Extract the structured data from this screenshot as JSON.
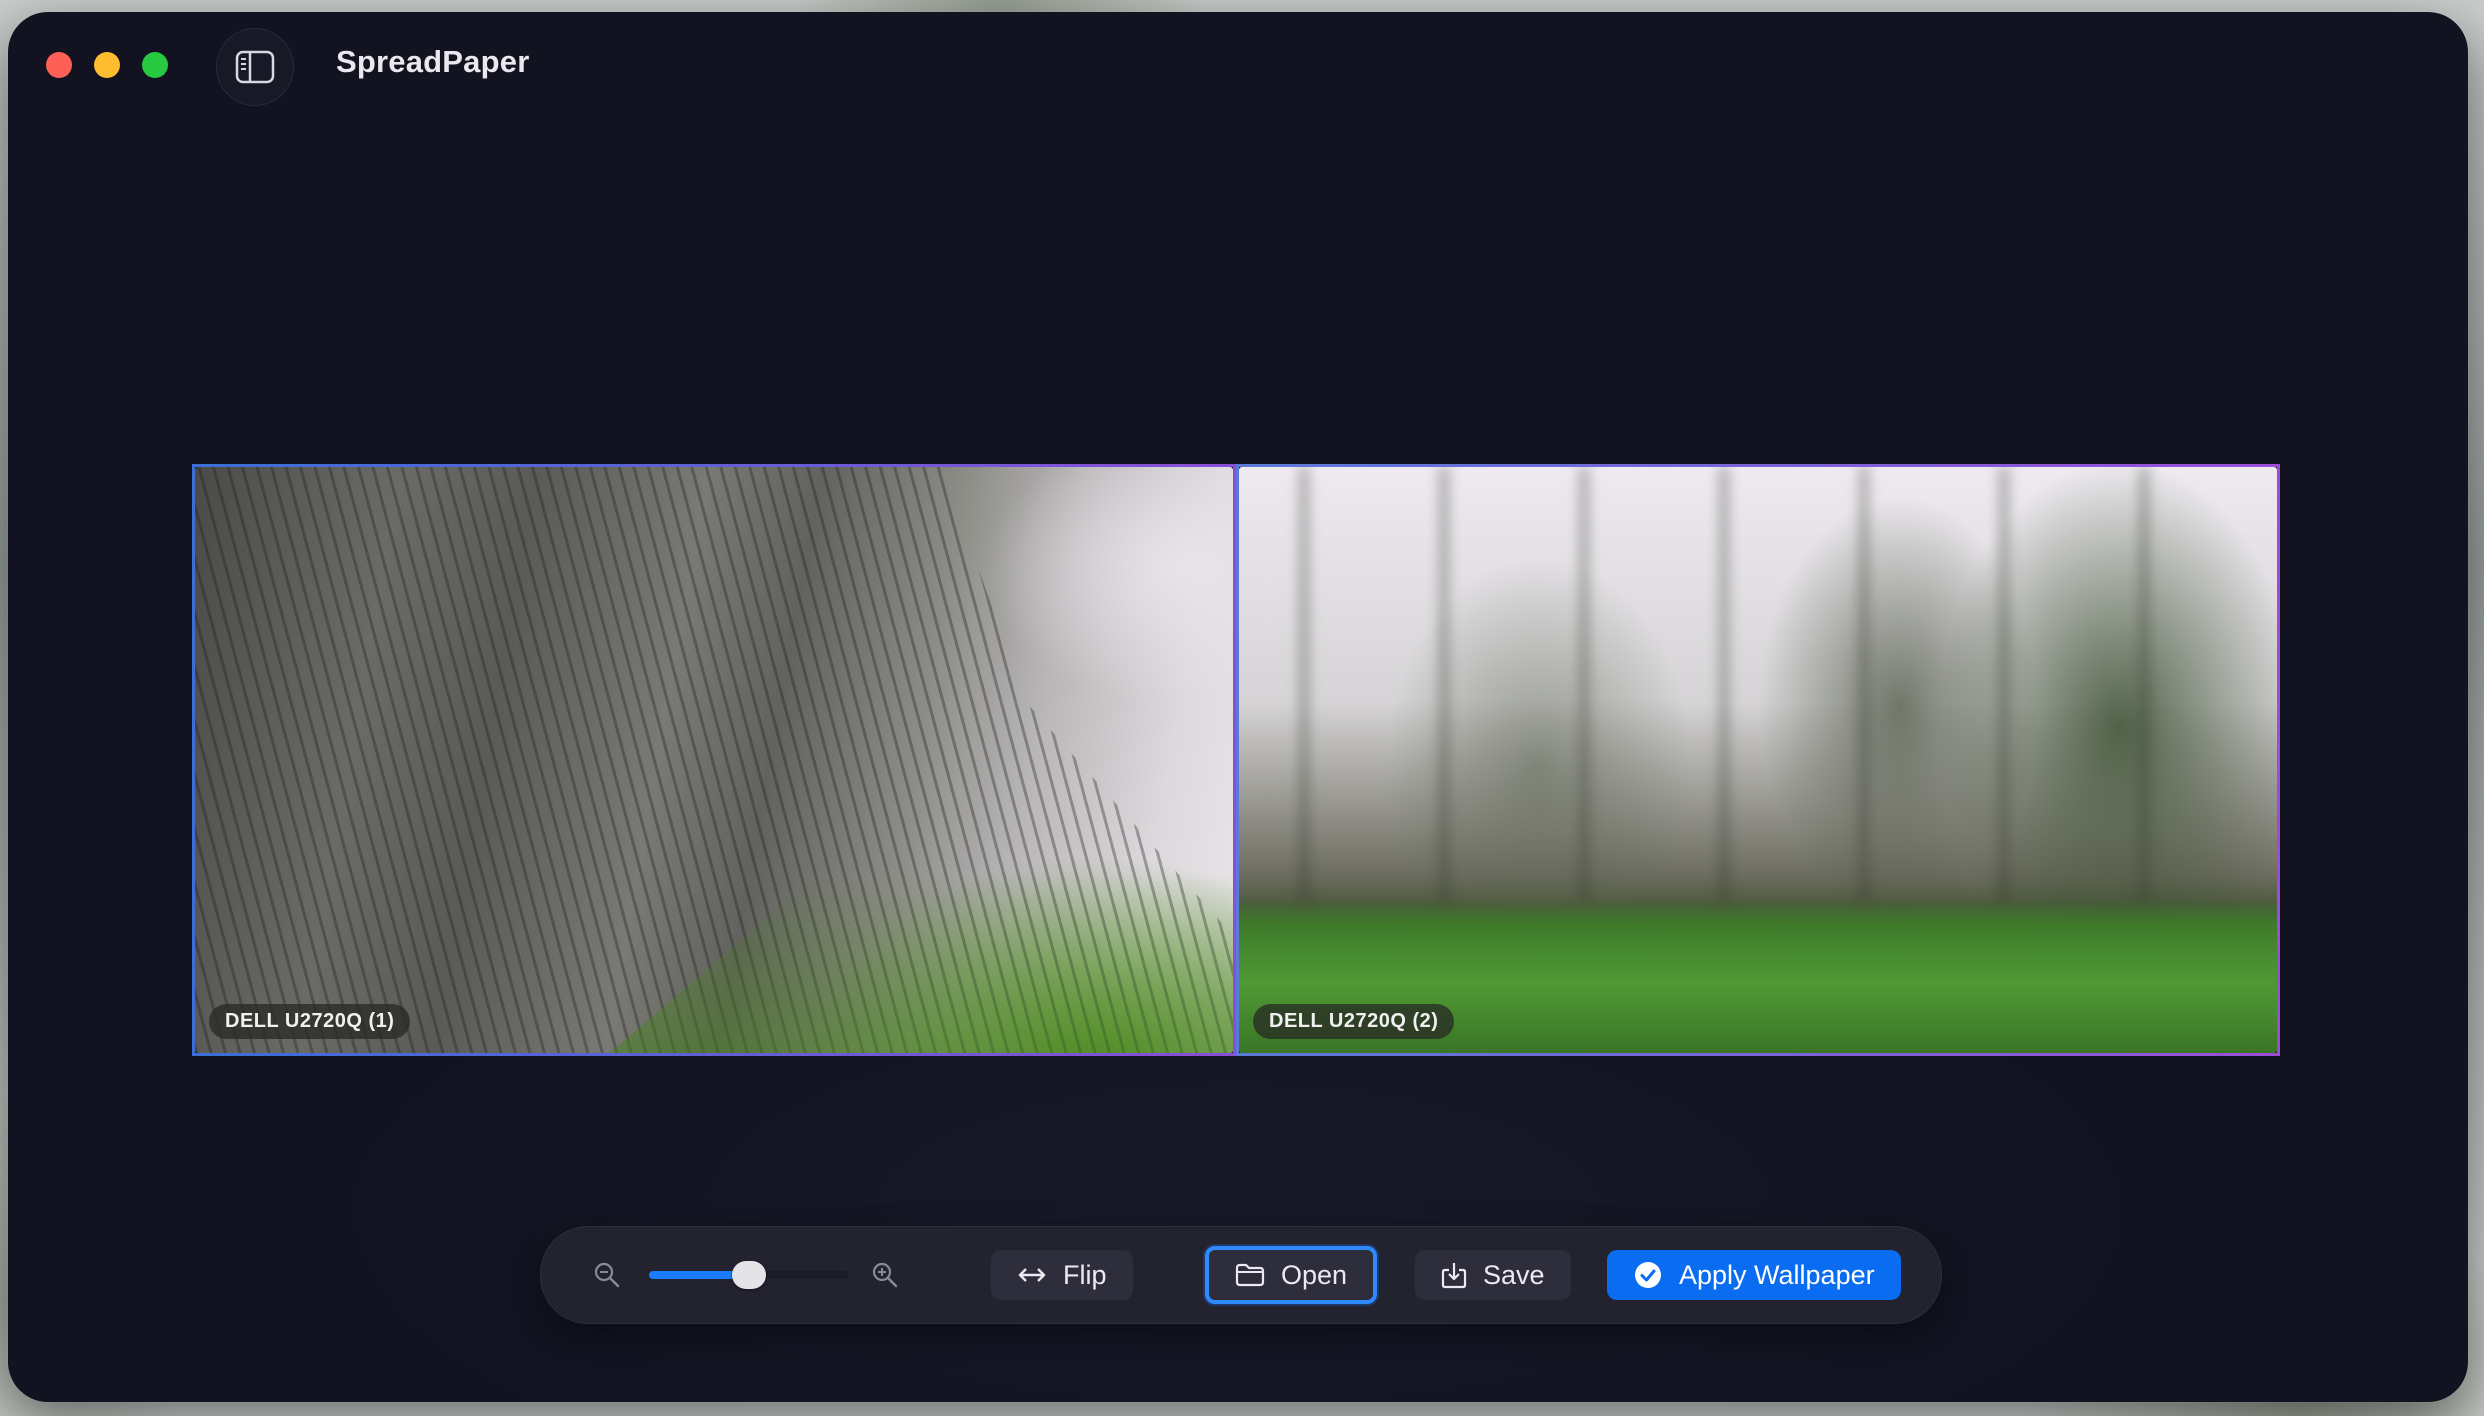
{
  "window": {
    "title": "SpreadPaper"
  },
  "titlebar": {
    "close_icon": "close-icon",
    "minimize_icon": "minimize-icon",
    "maximize_icon": "maximize-icon",
    "sidebar_toggle_icon": "sidebar-toggle-icon"
  },
  "preview": {
    "monitors": [
      {
        "label": "DELL U2720Q (1)"
      },
      {
        "label": "DELL U2720Q (2)"
      }
    ]
  },
  "toolbar": {
    "zoom": {
      "value": 0.5
    },
    "flip_label": "Flip",
    "open_label": "Open",
    "save_label": "Save",
    "apply_label": "Apply Wallpaper"
  },
  "colors": {
    "accent": "#0a6cf0",
    "window_bg": "#121220",
    "toolbar_bg": "#232330"
  }
}
